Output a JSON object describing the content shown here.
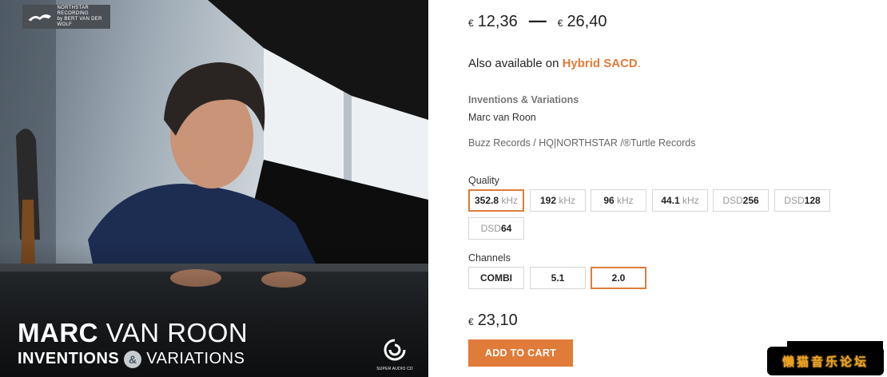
{
  "cover": {
    "label_line1": "NORTHSTAR",
    "label_line2": "RECORDING",
    "label_line3": "by BERT VAN DER WOLF",
    "artist_bold": "MARC",
    "artist_thin": "VAN ROON",
    "title_bold": "INVENTIONS",
    "title_amp": "&",
    "title_thin": "VARIATIONS",
    "sacd_text": "SUPER AUDIO CD"
  },
  "product": {
    "currency": "€",
    "price_min": "12,36",
    "price_max": "26,40",
    "also_prefix": "Also available on",
    "also_format": "Hybrid SACD",
    "also_suffix": ".",
    "album_title": "Inventions & Variations",
    "artist": "Marc van Roon",
    "labels": "Buzz Records / HQ|NORTHSTAR /®Turtle Records",
    "quality_label": "Quality",
    "quality_options": [
      {
        "value": "352.8",
        "unit": "kHz"
      },
      {
        "value": "192",
        "unit": "kHz"
      },
      {
        "value": "96",
        "unit": "kHz"
      },
      {
        "value": "44.1",
        "unit": "kHz"
      },
      {
        "prefix": "DSD",
        "value": "256"
      },
      {
        "prefix": "DSD",
        "value": "128"
      },
      {
        "prefix": "DSD",
        "value": "64"
      }
    ],
    "quality_selected": "352.8 kHz",
    "channels_label": "Channels",
    "channel_options": [
      "COMBI",
      "5.1",
      "2.0"
    ],
    "channel_selected": "2.0",
    "final_price": "23,10",
    "cart_label": "ADD TO CART"
  },
  "watermark": {
    "text": "懒猫音乐论坛"
  },
  "colors": {
    "accent": "#e07b39",
    "border": "#d6d6d6",
    "muted": "#777777"
  }
}
